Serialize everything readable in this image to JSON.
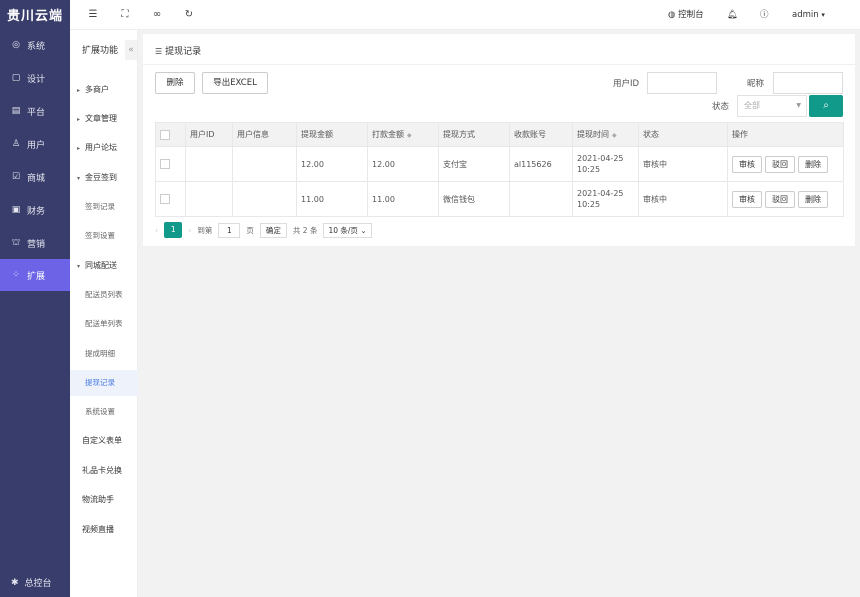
{
  "brand": "贵川云端",
  "nav": {
    "items": [
      {
        "label": "系统",
        "icon": "gear-icon",
        "glyph": "◎"
      },
      {
        "label": "设计",
        "icon": "design-icon",
        "glyph": "▢"
      },
      {
        "label": "平台",
        "icon": "platform-icon",
        "glyph": "▤"
      },
      {
        "label": "用户",
        "icon": "user-icon",
        "glyph": "♙"
      },
      {
        "label": "商城",
        "icon": "mall-icon",
        "glyph": "☑"
      },
      {
        "label": "财务",
        "icon": "finance-icon",
        "glyph": "▣"
      },
      {
        "label": "营销",
        "icon": "marketing-icon",
        "glyph": "⛫"
      },
      {
        "label": "扩展",
        "icon": "extension-icon",
        "glyph": "⁘"
      }
    ],
    "footer": "总控台"
  },
  "submenu": {
    "title": "扩展功能",
    "collapse": "«",
    "items": [
      {
        "label": "多商户"
      },
      {
        "label": "文章管理"
      },
      {
        "label": "用户论坛"
      },
      {
        "label": "金豆签到"
      },
      {
        "label": "签到记录"
      },
      {
        "label": "签到设置"
      },
      {
        "label": "同城配送"
      },
      {
        "label": "配送员列表"
      },
      {
        "label": "配送单列表"
      },
      {
        "label": "提成明细"
      },
      {
        "label": "提现记录"
      },
      {
        "label": "系统设置"
      },
      {
        "label": "自定义表单"
      },
      {
        "label": "礼品卡兑换"
      },
      {
        "label": "物流助手"
      },
      {
        "label": "视频直播"
      }
    ]
  },
  "topbar": {
    "console": "控制台",
    "user": "admin"
  },
  "page": {
    "title": "提现记录",
    "delete_btn": "删除",
    "export_btn": "导出EXCEL",
    "filters": {
      "user_id_label": "用户ID",
      "nickname_label": "昵称",
      "status_label": "状态",
      "status_value": "全部"
    }
  },
  "table": {
    "headers": [
      "用户ID",
      "用户信息",
      "提现金额",
      "打款金额",
      "提现方式",
      "收款账号",
      "提现时间",
      "状态",
      "操作"
    ],
    "rows": [
      {
        "user_id": "",
        "user_info": "",
        "amount": "12.00",
        "paid": "12.00",
        "method": "支付宝",
        "account": "al115626",
        "time": "2021-04-25 10:25",
        "status": "审核中",
        "ops": [
          "审核",
          "驳回",
          "删除"
        ]
      },
      {
        "user_id": "",
        "user_info": "",
        "amount": "11.00",
        "paid": "11.00",
        "method": "微信钱包",
        "account": "",
        "time": "2021-04-25 10:25",
        "status": "审核中",
        "ops": [
          "审核",
          "驳回",
          "删除"
        ]
      }
    ]
  },
  "pager": {
    "current": "1",
    "goto": "到第",
    "page_input": "1",
    "page_unit": "页",
    "confirm": "确定",
    "total": "共 2 条",
    "per_page": "10 条/页"
  },
  "colors": {
    "nav_bg": "#393d6b",
    "nav_active": "#6c63e6",
    "primary": "#119a89"
  }
}
